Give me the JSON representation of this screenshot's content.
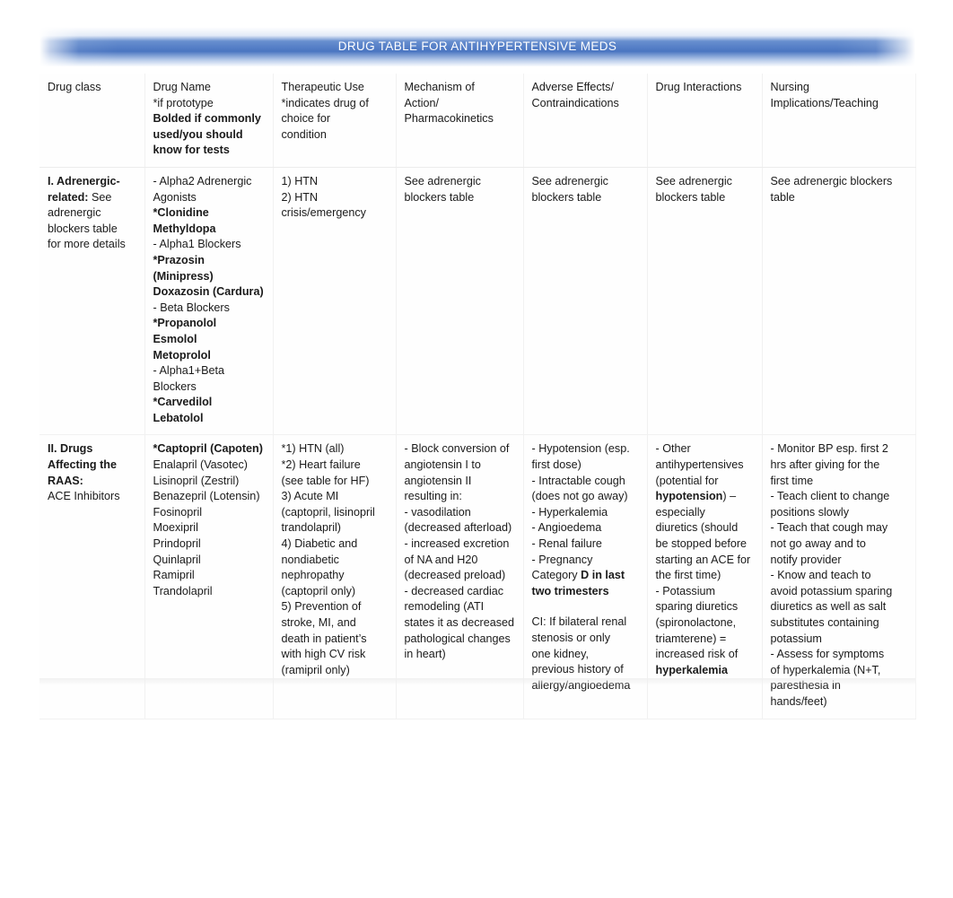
{
  "banner": {
    "title": "DRUG TABLE FOR ANTIHYPERTENSIVE MEDS",
    "color": "#4472C4",
    "text_color": "#FFFFFF"
  },
  "table": {
    "columns": [
      {
        "id": "drug-class",
        "lines": [
          {
            "text": "Drug class",
            "bold": false
          }
        ]
      },
      {
        "id": "drug-name",
        "lines": [
          {
            "text": "Drug Name",
            "bold": false
          },
          {
            "text": "*if prototype",
            "bold": false
          },
          {
            "text": "Bolded if commonly",
            "bold": true
          },
          {
            "text": "used/you should",
            "bold": true
          },
          {
            "text": "know for tests",
            "bold": true
          }
        ]
      },
      {
        "id": "therapeutic-use",
        "lines": [
          {
            "text": "Therapeutic Use",
            "bold": false
          },
          {
            "text": "*indicates drug of",
            "bold": false
          },
          {
            "text": "choice for",
            "bold": false
          },
          {
            "text": "condition",
            "bold": false
          }
        ]
      },
      {
        "id": "mechanism-of-action",
        "lines": [
          {
            "text": "Mechanism of",
            "bold": false
          },
          {
            "text": "Action/",
            "bold": false
          },
          {
            "text": "Pharmacokinetics",
            "bold": false
          }
        ]
      },
      {
        "id": "adverse-effects",
        "lines": [
          {
            "text": "Adverse Effects/",
            "bold": false
          },
          {
            "text": "Contraindications",
            "bold": false
          }
        ]
      },
      {
        "id": "drug-interactions",
        "lines": [
          {
            "text": "Drug Interactions",
            "bold": false
          }
        ]
      },
      {
        "id": "nursing-implications",
        "lines": [
          {
            "text": "Nursing",
            "bold": false
          },
          {
            "text": "Implications/Teaching",
            "bold": false
          }
        ]
      }
    ],
    "rows": [
      {
        "id": "row-adrenergic-related",
        "cells": [
          {
            "id": "cell-adrenergic-class",
            "lines": [
              {
                "text": "I. Adrenergic-",
                "bold": true
              },
              {
                "runs": [
                  {
                    "text": "related:",
                    "bold": true
                  },
                  {
                    "text": " See",
                    "bold": false
                  }
                ]
              },
              {
                "text": "adrenergic",
                "bold": false
              },
              {
                "text": "blockers table",
                "bold": false
              },
              {
                "text": "for more details",
                "bold": false
              }
            ]
          },
          {
            "id": "cell-adrenergic-drugs",
            "lines": [
              {
                "text": "- Alpha2 Adrenergic",
                "bold": false
              },
              {
                "text": "Agonists",
                "bold": false
              },
              {
                "text": "*Clonidine",
                "bold": true
              },
              {
                "text": "Methyldopa",
                "bold": true
              },
              {
                "text": "- Alpha1 Blockers",
                "bold": false
              },
              {
                "text": "*Prazosin (Minipress)",
                "bold": true
              },
              {
                "text": "Doxazosin (Cardura)",
                "bold": true
              },
              {
                "text": "- Beta Blockers",
                "bold": false
              },
              {
                "text": "*Propanolol",
                "bold": true
              },
              {
                "text": "Esmolol",
                "bold": true
              },
              {
                "text": "Metoprolol",
                "bold": true
              },
              {
                "text": "- Alpha1+Beta",
                "bold": false
              },
              {
                "text": "Blockers",
                "bold": false
              },
              {
                "text": "*Carvedilol",
                "bold": true
              },
              {
                "text": "Lebatolol",
                "bold": true
              }
            ]
          },
          {
            "id": "cell-adrenergic-use",
            "lines": [
              {
                "text": "1) HTN",
                "bold": false
              },
              {
                "text": "2) HTN",
                "bold": false
              },
              {
                "text": "crisis/emergency",
                "bold": false
              }
            ]
          },
          {
            "id": "cell-adrenergic-moa",
            "lines": [
              {
                "text": "See adrenergic",
                "bold": false
              },
              {
                "text": "blockers table",
                "bold": false
              }
            ]
          },
          {
            "id": "cell-adrenergic-adverse",
            "lines": [
              {
                "text": "See adrenergic",
                "bold": false
              },
              {
                "text": "blockers table",
                "bold": false
              }
            ]
          },
          {
            "id": "cell-adrenergic-interactions",
            "lines": [
              {
                "text": "See adrenergic",
                "bold": false
              },
              {
                "text": "blockers table",
                "bold": false
              }
            ]
          },
          {
            "id": "cell-adrenergic-nursing",
            "lines": [
              {
                "text": "See adrenergic blockers",
                "bold": false
              },
              {
                "text": "table",
                "bold": false
              }
            ]
          }
        ]
      },
      {
        "id": "row-raas-ace-inhibitors",
        "cells": [
          {
            "id": "cell-raas-class",
            "lines": [
              {
                "text": "II. Drugs",
                "bold": true
              },
              {
                "text": "Affecting the",
                "bold": true
              },
              {
                "text": "RAAS:",
                "bold": true
              },
              {
                "text": "ACE Inhibitors",
                "bold": false
              }
            ]
          },
          {
            "id": "cell-raas-drugs",
            "lines": [
              {
                "text": "*Captopril (Capoten)",
                "bold": true
              },
              {
                "text": "Enalapril (Vasotec)",
                "bold": false
              },
              {
                "text": "Lisinopril (Zestril)",
                "bold": false
              },
              {
                "text": "Benazepril (Lotensin)",
                "bold": false
              },
              {
                "text": "Fosinopril",
                "bold": false
              },
              {
                "text": "Moexipril",
                "bold": false
              },
              {
                "text": "Prindopril",
                "bold": false
              },
              {
                "text": "Quinlapril",
                "bold": false
              },
              {
                "text": "Ramipril",
                "bold": false
              },
              {
                "text": "Trandolapril",
                "bold": false
              }
            ]
          },
          {
            "id": "cell-raas-use",
            "lines": [
              {
                "text": "*1) HTN (all)",
                "bold": false
              },
              {
                "text": "*2) Heart failure",
                "bold": false
              },
              {
                "text": "(see table for HF)",
                "bold": false
              },
              {
                "text": "3) Acute MI",
                "bold": false
              },
              {
                "text": "(captopril, lisinopril",
                "bold": false
              },
              {
                "text": "trandolapril)",
                "bold": false
              },
              {
                "text": "4) Diabetic and",
                "bold": false
              },
              {
                "text": "nondiabetic",
                "bold": false
              },
              {
                "text": "nephropathy",
                "bold": false
              },
              {
                "text": "(captopril only)",
                "bold": false
              },
              {
                "text": "5) Prevention of",
                "bold": false
              },
              {
                "text": "stroke, MI, and",
                "bold": false
              },
              {
                "text": "death in patient’s",
                "bold": false
              },
              {
                "text": "with high CV risk",
                "bold": false
              },
              {
                "text": "(ramipril only)",
                "bold": false
              }
            ]
          },
          {
            "id": "cell-raas-moa",
            "lines": [
              {
                "text": "- Block conversion of",
                "bold": false
              },
              {
                "text": "angiotensin I to",
                "bold": false
              },
              {
                "text": "angiotensin II",
                "bold": false
              },
              {
                "text": "resulting in:",
                "bold": false
              },
              {
                "text": "- vasodilation",
                "bold": false
              },
              {
                "text": "(decreased afterload)",
                "bold": false
              },
              {
                "text": "- increased excretion",
                "bold": false
              },
              {
                "text": "of NA and H20",
                "bold": false
              },
              {
                "text": "(decreased preload)",
                "bold": false
              },
              {
                "text": "- decreased cardiac",
                "bold": false
              },
              {
                "text": "remodeling (ATI",
                "bold": false
              },
              {
                "text": "states it as decreased",
                "bold": false
              },
              {
                "text": "pathological changes",
                "bold": false
              },
              {
                "text": "in heart)",
                "bold": false
              }
            ]
          },
          {
            "id": "cell-raas-adverse",
            "lines": [
              {
                "text": "- Hypotension (esp.",
                "bold": false
              },
              {
                "text": "first dose)",
                "bold": false
              },
              {
                "text": "- Intractable cough",
                "bold": false
              },
              {
                "text": "(does not go away)",
                "bold": false
              },
              {
                "text": "- Hyperkalemia",
                "bold": false
              },
              {
                "text": "- Angioedema",
                "bold": false
              },
              {
                "text": "- Renal failure",
                "bold": false
              },
              {
                "text": "- Pregnancy",
                "bold": false
              },
              {
                "runs": [
                  {
                    "text": "Category ",
                    "bold": false
                  },
                  {
                    "text": "D in last",
                    "bold": true
                  }
                ]
              },
              {
                "text": "two trimesters",
                "bold": true
              },
              {
                "spacer": true
              },
              {
                "text": "CI: If bilateral renal",
                "bold": false
              },
              {
                "text": "stenosis or only",
                "bold": false
              },
              {
                "text": "one kidney,",
                "bold": false
              },
              {
                "text": "previous history of",
                "bold": false
              },
              {
                "text": "allergy/angioedema",
                "bold": false
              }
            ]
          },
          {
            "id": "cell-raas-interactions",
            "lines": [
              {
                "text": "- Other",
                "bold": false
              },
              {
                "text": "antihypertensives",
                "bold": false
              },
              {
                "text": "(potential for",
                "bold": false
              },
              {
                "runs": [
                  {
                    "text": "hypotension",
                    "bold": true
                  },
                  {
                    "text": ") –",
                    "bold": false
                  }
                ]
              },
              {
                "text": "especially",
                "bold": false
              },
              {
                "text": "diuretics (should",
                "bold": false
              },
              {
                "text": "be stopped before",
                "bold": false
              },
              {
                "text": "starting an ACE for",
                "bold": false
              },
              {
                "text": "the first time)",
                "bold": false
              },
              {
                "text": "- Potassium",
                "bold": false
              },
              {
                "text": "sparing diuretics",
                "bold": false
              },
              {
                "text": "(spironolactone,",
                "bold": false
              },
              {
                "text": "triamterene) =",
                "bold": false
              },
              {
                "text": "increased risk of",
                "bold": false
              },
              {
                "text": "hyperkalemia",
                "bold": true
              }
            ]
          },
          {
            "id": "cell-raas-nursing",
            "lines": [
              {
                "text": "- Monitor BP esp. first 2",
                "bold": false
              },
              {
                "text": "hrs after giving for the",
                "bold": false
              },
              {
                "text": "first time",
                "bold": false
              },
              {
                "text": "- Teach client to change",
                "bold": false
              },
              {
                "text": "positions slowly",
                "bold": false
              },
              {
                "text": "- Teach that cough may",
                "bold": false
              },
              {
                "text": "not go away and to",
                "bold": false
              },
              {
                "text": "notify provider",
                "bold": false
              },
              {
                "text": "- Know and teach to",
                "bold": false
              },
              {
                "text": "avoid potassium sparing",
                "bold": false
              },
              {
                "text": "diuretics as well as salt",
                "bold": false
              },
              {
                "text": "substitutes containing",
                "bold": false
              },
              {
                "text": "potassium",
                "bold": false
              },
              {
                "text": "- Assess for symptoms",
                "bold": false
              },
              {
                "text": "of hyperkalemia (N+T,",
                "bold": false
              },
              {
                "text": "paresthesia in",
                "bold": false
              },
              {
                "text": "hands/feet)",
                "bold": false
              }
            ]
          }
        ]
      }
    ]
  }
}
